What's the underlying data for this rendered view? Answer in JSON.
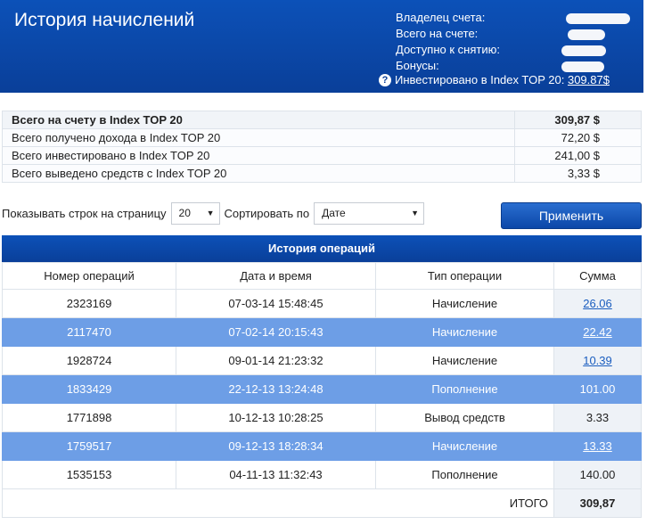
{
  "header": {
    "title": "История начислений",
    "owner_label": "Владелец счета:",
    "total_label": "Всего на счете:",
    "available_label": "Доступно к снятию:",
    "bonus_label": "Бонусы:",
    "invested_label": "Инвестировано в Index TOP 20:",
    "invested_value": "309.87$"
  },
  "summary": [
    {
      "label": "Всего на счету в Index TOP 20",
      "value": "309,87 $"
    },
    {
      "label": "Всего получено дохода в Index TOP 20",
      "value": "72,20 $"
    },
    {
      "label": "Всего инвестировано в Index TOP 20",
      "value": "241,00 $"
    },
    {
      "label": "Всего выведено средств с Index TOP 20",
      "value": "3,33 $"
    }
  ],
  "controls": {
    "rows_label": "Показывать строк на страницу",
    "rows_value": "20",
    "sort_label": "Сортировать по",
    "sort_value": "Дате",
    "apply_label": "Применить"
  },
  "ops": {
    "caption": "История операций",
    "headers": [
      "Номер операций",
      "Дата и время",
      "Тип операции",
      "Сумма"
    ],
    "rows": [
      {
        "id": "2323169",
        "date": "07-03-14 15:48:45",
        "type": "Начисление",
        "amount": "26.06"
      },
      {
        "id": "2117470",
        "date": "07-02-14 20:15:43",
        "type": "Начисление",
        "amount": "22.42"
      },
      {
        "id": "1928724",
        "date": "09-01-14 21:23:32",
        "type": "Начисление",
        "amount": "10.39"
      },
      {
        "id": "1833429",
        "date": "22-12-13 13:24:48",
        "type": "Пополнение",
        "amount": "101.00"
      },
      {
        "id": "1771898",
        "date": "10-12-13 10:28:25",
        "type": "Вывод средств",
        "amount": "3.33"
      },
      {
        "id": "1759517",
        "date": "09-12-13 18:28:34",
        "type": "Начисление",
        "amount": "13.33"
      },
      {
        "id": "1535153",
        "date": "04-11-13 11:32:43",
        "type": "Пополнение",
        "amount": "140.00"
      }
    ],
    "total_label": "ИТОГО",
    "total_value": "309,87"
  },
  "colors": {
    "header_blue": "#0a3f99",
    "row_highlight": "#6d9ee6",
    "link": "#1a5dbf"
  }
}
